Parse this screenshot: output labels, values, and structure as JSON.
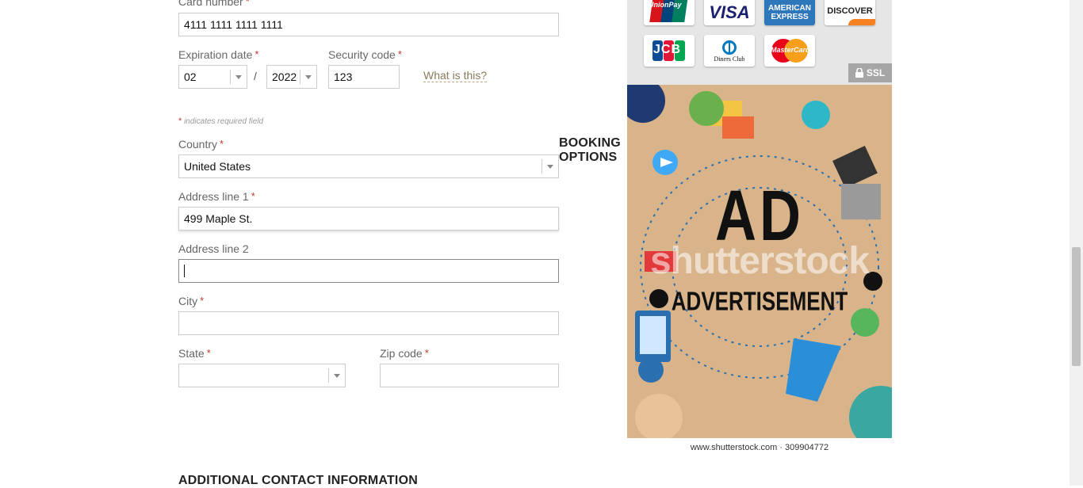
{
  "form": {
    "card_number_label": "Card number",
    "card_number_value": "4111 1111 1111 1111",
    "expiration_label": "Expiration date",
    "exp_month": "02",
    "exp_separator": "/",
    "exp_year": "2022",
    "security_label": "Security code",
    "security_value": "123",
    "what_is_this": "What is this?",
    "required_star": "*",
    "required_note": "indicates required field",
    "country_label": "Country",
    "country_value": "United States",
    "address1_label": "Address line 1",
    "address1_value": "499 Maple St.",
    "address2_label": "Address line 2",
    "address2_value": "",
    "city_label": "City",
    "city_value": "",
    "state_label": "State",
    "state_value": "",
    "zip_label": "Zip code",
    "zip_value": ""
  },
  "section": {
    "booking_options": "BOOKING OPTIONS",
    "additional_contact": "ADDITIONAL CONTACT INFORMATION"
  },
  "payment": {
    "cards": [
      "UnionPay",
      "VISA",
      "AMERICAN EXPRESS",
      "DISCOVER",
      "JCB",
      "Diners Club",
      "MasterCard"
    ],
    "ssl_label": "SSL"
  },
  "ad": {
    "headline": "AD",
    "subline": "ADVERTISEMENT",
    "watermark": "shutterstock",
    "caption": "www.shutterstock.com · 309904772"
  },
  "colors": {
    "required": "#c0392b",
    "link": "#8a7a5a",
    "visa_blue": "#1a1f71",
    "amex_blue": "#2e77bb",
    "discover_orange": "#f68121",
    "mastercard_red": "#eb001b",
    "mastercard_yellow": "#f79e1b",
    "ad_background": "#d9b48a"
  }
}
